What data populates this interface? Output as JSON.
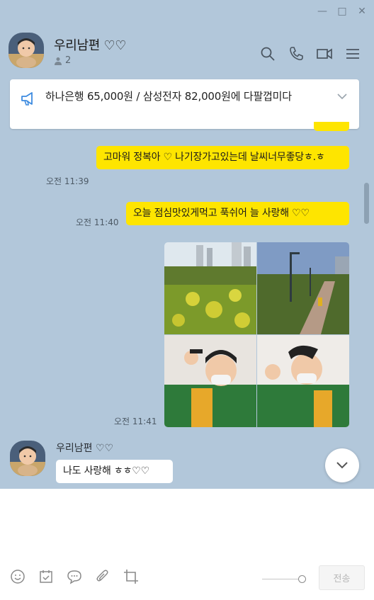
{
  "window": {
    "minimize": "—",
    "maximize": "□",
    "close": "✕"
  },
  "header": {
    "title": "우리남편 ♡♡",
    "member_count": "2"
  },
  "notice": {
    "text": "하나은행 65,000원 / 삼성전자 82,000원에 다팔껍미다"
  },
  "messages": [
    {
      "from": "me",
      "text": "고마워 정복아 ♡ 나기장가고있는데 날씨너무좋당ㅎ.ㅎ",
      "time": "오전 11:39"
    },
    {
      "from": "me",
      "text": "오늘 점심맛있게먹고 푹쉬어 늘 사랑해 ♡♡",
      "time": "오전 11:40"
    },
    {
      "from": "me",
      "type": "photos",
      "time": "오전 11:41"
    },
    {
      "from": "other",
      "sender": "우리남편 ♡♡",
      "text": "나도 사랑해 ㅎㅎ♡♡"
    }
  ],
  "composer": {
    "value": "",
    "send_label": "전송"
  },
  "colors": {
    "chat_bg": "#b2c7da",
    "my_bubble": "#fee500",
    "their_bubble": "#ffffff"
  }
}
